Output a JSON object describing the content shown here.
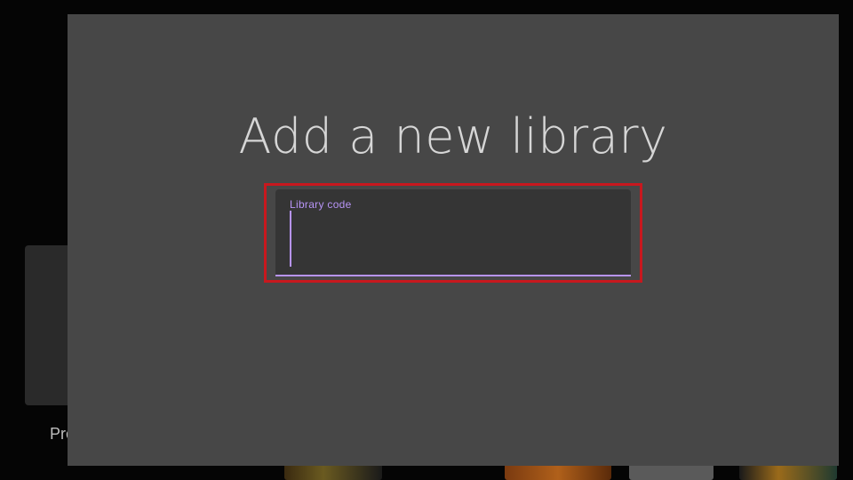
{
  "background": {
    "card_label": "Pre"
  },
  "dialog": {
    "title": "Add a new library",
    "field": {
      "label": "Library code",
      "value": "",
      "placeholder": ""
    }
  },
  "colors": {
    "dialog_bg": "#474747",
    "field_bg": "#353535",
    "accent": "#b794f6",
    "focus_ring": "#c8181e",
    "title_text": "#d6d6d6"
  }
}
